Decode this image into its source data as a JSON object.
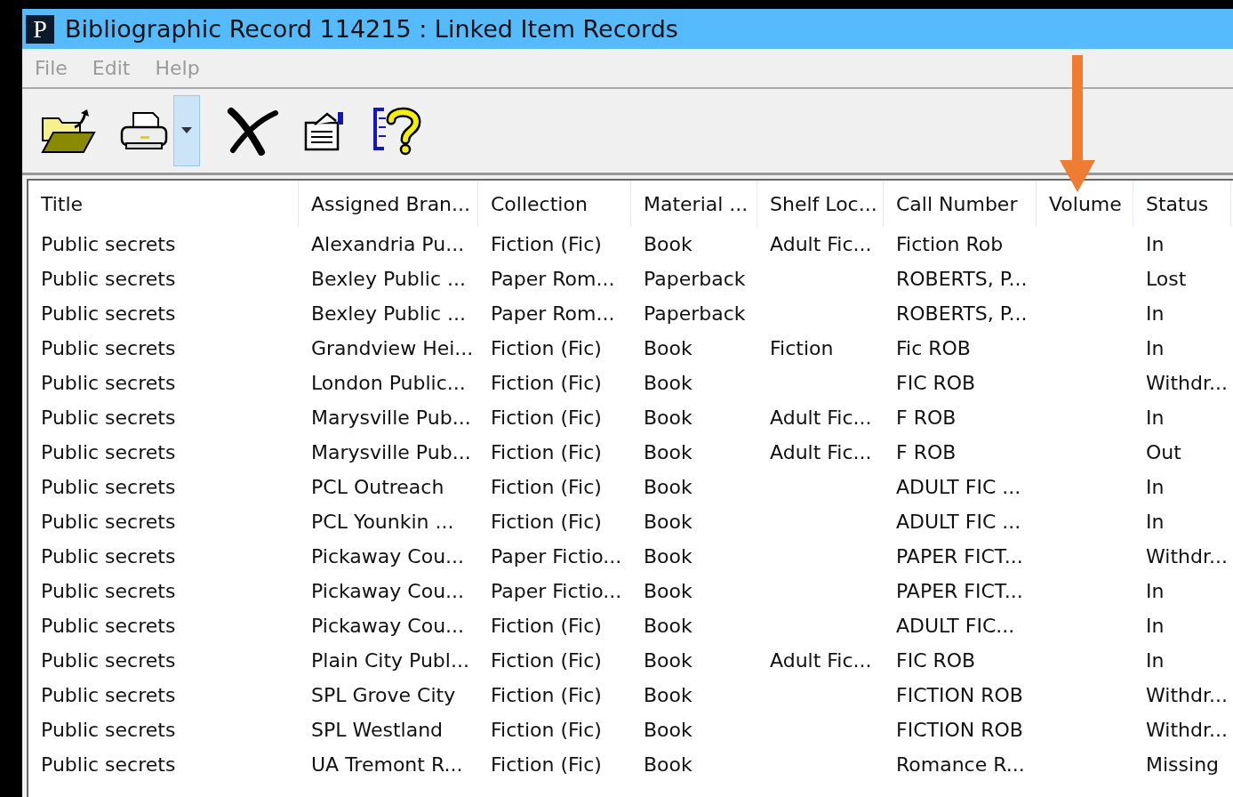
{
  "window": {
    "title": "Bibliographic Record 114215 : Linked Item Records",
    "app_letter": "P"
  },
  "menu": [
    {
      "label": "File",
      "disabled": true
    },
    {
      "label": "Edit",
      "disabled": true
    },
    {
      "label": "Help",
      "disabled": true
    }
  ],
  "toolbar": [
    {
      "kind": "open"
    },
    {
      "kind": "print"
    },
    {
      "kind": "dropdown",
      "selected": true
    },
    {
      "kind": "delete"
    },
    {
      "kind": "properties"
    },
    {
      "kind": "help"
    }
  ],
  "table": {
    "columns": [
      "Title",
      "Assigned Bran...",
      "Collection",
      "Material ...",
      "Shelf Loc...",
      "Call Number",
      "Volume",
      "Status"
    ],
    "rows": [
      [
        "Public secrets",
        "Alexandria Pu...",
        "Fiction (Fic)",
        "Book",
        "Adult Fic...",
        "Fiction Rob",
        "",
        "In"
      ],
      [
        "Public secrets",
        "Bexley Public ...",
        "Paper Rom...",
        "Paperback",
        "",
        "ROBERTS, P...",
        "",
        "Lost"
      ],
      [
        "Public secrets",
        "Bexley Public ...",
        "Paper Rom...",
        "Paperback",
        "",
        "ROBERTS, P...",
        "",
        "In"
      ],
      [
        "Public secrets",
        "Grandview Hei...",
        "Fiction (Fic)",
        "Book",
        "Fiction",
        "Fic ROB",
        "",
        "In"
      ],
      [
        "Public secrets",
        "London Public...",
        "Fiction (Fic)",
        "Book",
        "",
        "FIC ROB",
        "",
        "Withdr..."
      ],
      [
        "Public secrets",
        "Marysville Pub...",
        "Fiction (Fic)",
        "Book",
        "Adult Fic...",
        "F ROB",
        "",
        "In"
      ],
      [
        "Public secrets",
        "Marysville Pub...",
        "Fiction (Fic)",
        "Book",
        "Adult Fic...",
        "F ROB",
        "",
        "Out"
      ],
      [
        "Public secrets",
        "PCL Outreach",
        "Fiction (Fic)",
        "Book",
        "",
        "ADULT FIC ...",
        "",
        "In"
      ],
      [
        "Public secrets",
        "PCL Younkin ...",
        "Fiction (Fic)",
        "Book",
        "",
        "ADULT FIC ...",
        "",
        "In"
      ],
      [
        "Public secrets",
        "Pickaway Cou...",
        "Paper Fictio...",
        "Book",
        "",
        "PAPER FICT...",
        "",
        "Withdr..."
      ],
      [
        "Public secrets",
        "Pickaway Cou...",
        "Paper Fictio...",
        "Book",
        "",
        "PAPER FICT...",
        "",
        "In"
      ],
      [
        "Public secrets",
        "Pickaway Cou...",
        "Fiction (Fic)",
        "Book",
        "",
        "ADULT FIC...",
        "",
        "In"
      ],
      [
        "Public secrets",
        "Plain City Publ...",
        "Fiction (Fic)",
        "Book",
        "Adult Fic...",
        "FIC ROB",
        "",
        "In"
      ],
      [
        "Public secrets",
        "SPL Grove City",
        "Fiction (Fic)",
        "Book",
        "",
        "FICTION ROB",
        "",
        "Withdr..."
      ],
      [
        "Public secrets",
        "SPL Westland",
        "Fiction (Fic)",
        "Book",
        "",
        "FICTION ROB",
        "",
        "Withdr..."
      ],
      [
        "Public secrets",
        "UA Tremont R...",
        "Fiction (Fic)",
        "Book",
        "",
        "Romance R...",
        "",
        "Missing"
      ]
    ]
  }
}
